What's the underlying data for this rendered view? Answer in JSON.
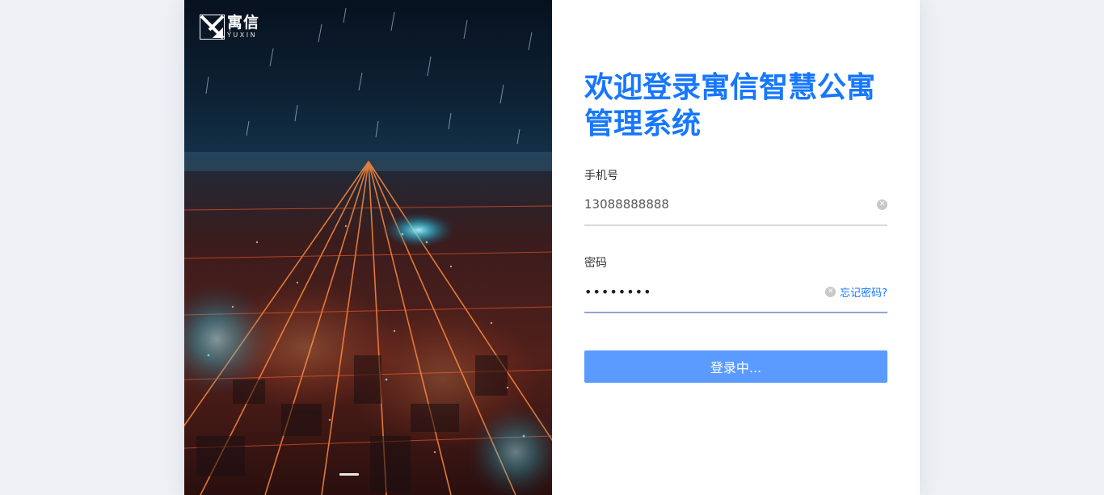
{
  "brand": {
    "name_cn": "寓信",
    "name_en": "YUXIN"
  },
  "hero": {
    "image": "night-city-aerial-photo",
    "logo_icon": "yuxin-logo-icon"
  },
  "login": {
    "title": "欢迎登录寓信智慧公寓管理系统",
    "phone": {
      "label": "手机号",
      "value": "13088888888",
      "clear_icon": "clear-icon"
    },
    "password": {
      "label": "密码",
      "value": "••••••••",
      "clear_icon": "clear-icon",
      "forgot_link": "忘记密码?"
    },
    "submit_button": "登录中..."
  },
  "colors": {
    "accent": "#1677ff",
    "button": "#5b9bff",
    "page_background": "#eef0f5"
  }
}
